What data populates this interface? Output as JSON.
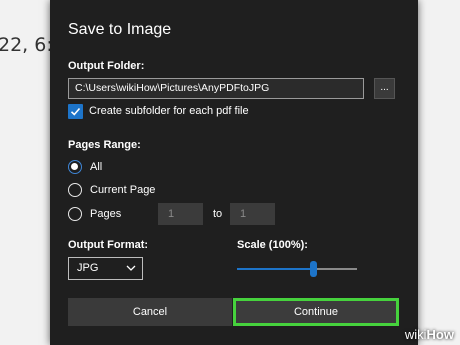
{
  "background": {
    "visible_text": "22, 6:5"
  },
  "dialog": {
    "title": "Save to Image",
    "output_folder": {
      "label": "Output Folder:",
      "path": "C:\\Users\\wikiHow\\Pictures\\AnyPDFtoJPG",
      "browse_label": "..."
    },
    "subfolder_checkbox": {
      "label": "Create subfolder for each pdf file",
      "checked": true
    },
    "pages_range": {
      "label": "Pages Range:",
      "options": [
        {
          "label": "All",
          "selected": true
        },
        {
          "label": "Current Page",
          "selected": false
        },
        {
          "label": "Pages",
          "selected": false
        }
      ],
      "from_value": "1",
      "to_label": "to",
      "to_value": "1"
    },
    "output_format": {
      "label": "Output Format:",
      "value": "JPG"
    },
    "scale": {
      "label": "Scale (100%):",
      "level_fraction": 0.63
    },
    "buttons": {
      "cancel": "Cancel",
      "continue": "Continue"
    }
  },
  "watermark": {
    "prefix": "wiki",
    "suffix": "How"
  },
  "colors": {
    "accent": "#1d74c9",
    "highlight": "#46d23d",
    "dialog_bg": "#1f1f1f"
  }
}
